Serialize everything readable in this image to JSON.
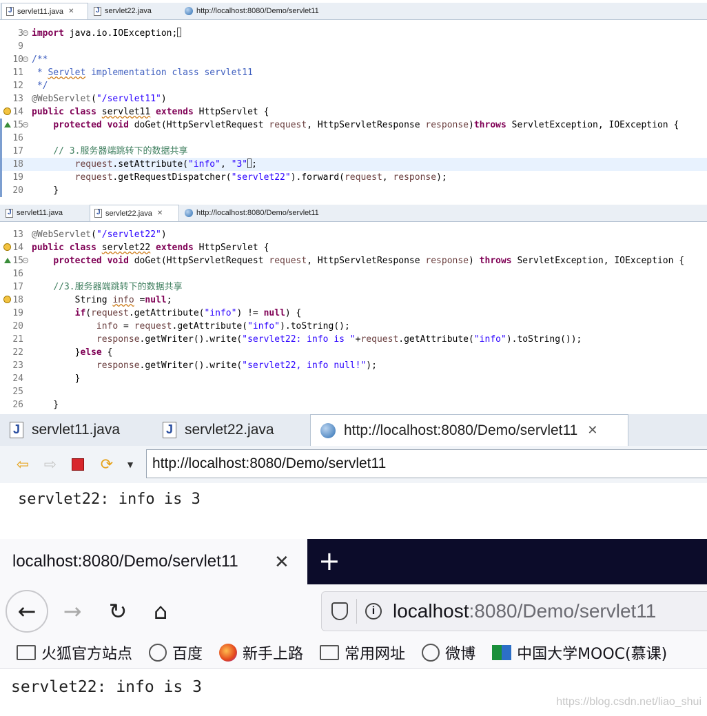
{
  "editor1": {
    "tabs": [
      "servlet11.java",
      "servlet22.java",
      "http://localhost:8080/Demo/servlet11"
    ],
    "lines": [
      {
        "n": "3",
        "fold": true,
        "html": "<span class='kw'>import</span> java.io.IOException;<span class='caret'></span>"
      },
      {
        "n": "9",
        "html": ""
      },
      {
        "n": "10",
        "fold": true,
        "html": "<span class='jd'>/**</span>"
      },
      {
        "n": "11",
        "html": "<span class='jd'> * <span class='sq'>Servlet</span> implementation class servlet11</span>"
      },
      {
        "n": "12",
        "html": "<span class='jd'> */</span>"
      },
      {
        "n": "13",
        "html": "<span class='ann'>@WebServlet</span>(<span class='str'>\"/servlet11\"</span>)"
      },
      {
        "n": "14",
        "warn": true,
        "html": "<span class='kw'>public</span> <span class='kw'>class</span> <span class='sq'>servlet11</span> <span class='kw'>extends</span> HttpServlet {"
      },
      {
        "n": "15",
        "fold": true,
        "ov": true,
        "ruler": true,
        "html": "    <span class='kw'>protected</span> <span class='kw'>void</span> doGet(HttpServletRequest <span class='vr'>request</span>, HttpServletResponse <span class='vr'>response</span>)<span class='kw'>throws</span> ServletException, IOException {"
      },
      {
        "n": "16",
        "ruler": true,
        "html": ""
      },
      {
        "n": "17",
        "ruler": true,
        "html": "    <span class='cm'>// 3.服务器端跳转下的数据共享</span>"
      },
      {
        "n": "18",
        "ruler": true,
        "hl": true,
        "html": "        <span class='vr'>request</span>.setAttribute(<span class='str'>\"info\"</span>, <span class='str'>\"3\"</span><span class='caret'></span>;"
      },
      {
        "n": "19",
        "ruler": true,
        "html": "        <span class='vr'>request</span>.getRequestDispatcher(<span class='str'>\"servlet22\"</span>).forward(<span class='vr'>request</span>, <span class='vr'>response</span>);"
      },
      {
        "n": "20",
        "ruler": true,
        "html": "    }"
      }
    ]
  },
  "editor2": {
    "tabs": [
      "servlet11.java",
      "servlet22.java",
      "http://localhost:8080/Demo/servlet11"
    ],
    "lines": [
      {
        "n": "13",
        "html": "<span class='ann'>@WebServlet</span>(<span class='str'>\"/servlet22\"</span>)"
      },
      {
        "n": "14",
        "warn": true,
        "html": "<span class='kw'>public</span> <span class='kw'>class</span> <span class='sq'>servlet22</span> <span class='kw'>extends</span> HttpServlet {"
      },
      {
        "n": "15",
        "fold": true,
        "ov": true,
        "html": "    <span class='kw'>protected</span> <span class='kw'>void</span> doGet(HttpServletRequest <span class='vr'>request</span>, HttpServletResponse <span class='vr'>response</span>) <span class='kw'>throws</span> ServletException, IOException {"
      },
      {
        "n": "16",
        "html": ""
      },
      {
        "n": "17",
        "html": "    <span class='cm'>//3.服务器端跳转下的数据共享</span>"
      },
      {
        "n": "18",
        "warn": true,
        "html": "        String <span class='sq vr'>info</span> =<span class='kw'>null</span>;"
      },
      {
        "n": "19",
        "html": "        <span class='kw'>if</span>(<span class='vr'>request</span>.getAttribute(<span class='str'>\"info\"</span>) != <span class='kw'>null</span>) {"
      },
      {
        "n": "20",
        "html": "            <span class='vr'>info</span> = <span class='vr'>request</span>.getAttribute(<span class='str'>\"info\"</span>).toString();"
      },
      {
        "n": "21",
        "html": "            <span class='vr'>response</span>.getWriter().write(<span class='str'>\"servlet22: info is \"</span>+<span class='vr'>request</span>.getAttribute(<span class='str'>\"info\"</span>).toString());"
      },
      {
        "n": "22",
        "html": "        }<span class='kw'>else</span> {"
      },
      {
        "n": "23",
        "html": "            <span class='vr'>response</span>.getWriter().write(<span class='str'>\"servlet22, info null!\"</span>);"
      },
      {
        "n": "24",
        "html": "        }"
      },
      {
        "n": "25",
        "html": ""
      },
      {
        "n": "26",
        "html": "    }"
      }
    ]
  },
  "eclipse_browser": {
    "tabs": [
      "servlet11.java",
      "servlet22.java",
      "http://localhost:8080/Demo/servlet11"
    ],
    "url": "http://localhost:8080/Demo/servlet11",
    "content": "servlet22: info is 3"
  },
  "firefox": {
    "tab_title": "localhost:8080/Demo/servlet11",
    "url_host": "localhost",
    "url_path": ":8080/Demo/servlet11",
    "bookmarks": [
      "火狐官方站点",
      "百度",
      "新手上路",
      "常用网址",
      "微博",
      "中国大学MOOC(慕课)"
    ],
    "content": "servlet22: info is 3"
  },
  "watermark": "https://blog.csdn.net/liao_shui",
  "colors": {
    "keyword": "#7f0055",
    "string": "#2a00ff",
    "comment": "#3f7f5f",
    "firefox_tabstrip": "#0c0c2a"
  }
}
